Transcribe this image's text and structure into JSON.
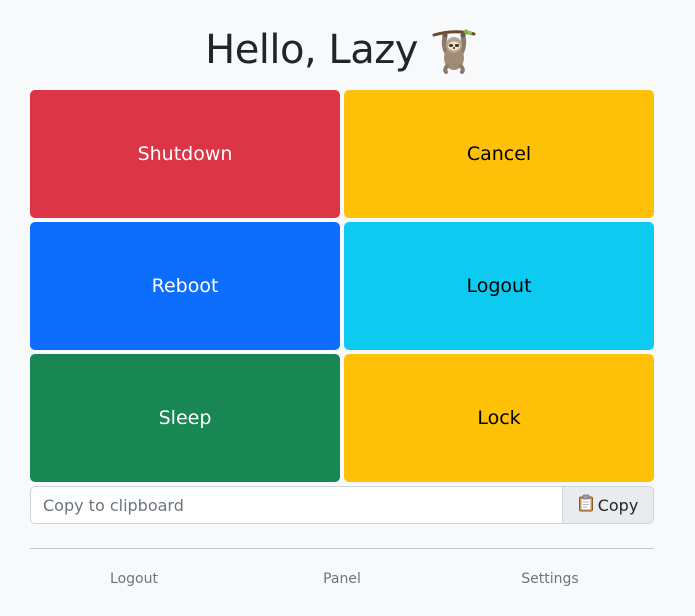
{
  "header": {
    "title": "Hello, Lazy",
    "emoji_icon": "sloth-icon"
  },
  "buttons": [
    {
      "label": "Shutdown",
      "bg": "#dc3545",
      "fg": "#ffffff"
    },
    {
      "label": "Cancel",
      "bg": "#ffc107",
      "fg": "#000000"
    },
    {
      "label": "Reboot",
      "bg": "#0d6efd",
      "fg": "#ffffff"
    },
    {
      "label": "Logout",
      "bg": "#0dcaf0",
      "fg": "#000000"
    },
    {
      "label": "Sleep",
      "bg": "#198754",
      "fg": "#ffffff"
    },
    {
      "label": "Lock",
      "bg": "#ffc107",
      "fg": "#000000"
    }
  ],
  "clipboard": {
    "placeholder": "Copy to clipboard",
    "value": "",
    "copy_label": "Copy",
    "copy_icon": "clipboard-icon"
  },
  "footer": {
    "links": [
      "Logout",
      "Panel",
      "Settings"
    ]
  }
}
